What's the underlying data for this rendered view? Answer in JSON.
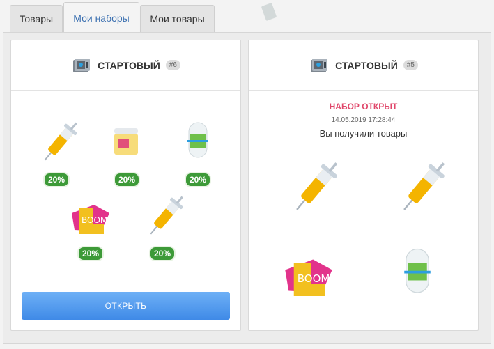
{
  "tabs": [
    {
      "label": "Товары",
      "active": false
    },
    {
      "label": "Мои наборы",
      "active": true
    },
    {
      "label": "Мои товары",
      "active": false
    }
  ],
  "kits": [
    {
      "title": "СТАРТОВЫЙ",
      "number": "#6",
      "icon": "safe-icon",
      "items": [
        {
          "icon": "syringe-icon",
          "discount": "20%"
        },
        {
          "icon": "jar-icon",
          "discount": "20%"
        },
        {
          "icon": "pill-capsule-icon",
          "discount": "20%"
        },
        {
          "icon": "boom-boot-icon",
          "discount": "20%"
        },
        {
          "icon": "syringe-icon",
          "discount": "20%"
        }
      ],
      "button_label": "ОТКРЫТЬ"
    },
    {
      "title": "СТАРТОВЫЙ",
      "number": "#5",
      "icon": "safe-icon",
      "status": "НАБОР ОТКРЫТ",
      "date": "14.05.2019 17:28:44",
      "message": "Вы получили товары",
      "items": [
        {
          "icon": "syringe-icon"
        },
        {
          "icon": "syringe-icon"
        },
        {
          "icon": "boom-boot-icon"
        },
        {
          "icon": "pill-capsule-icon"
        }
      ]
    }
  ],
  "colors": {
    "accent_blue": "#4a92ea",
    "discount_green": "#3d9a38",
    "opened_pink": "#e0476a",
    "active_tab_text": "#3a6fb0"
  }
}
